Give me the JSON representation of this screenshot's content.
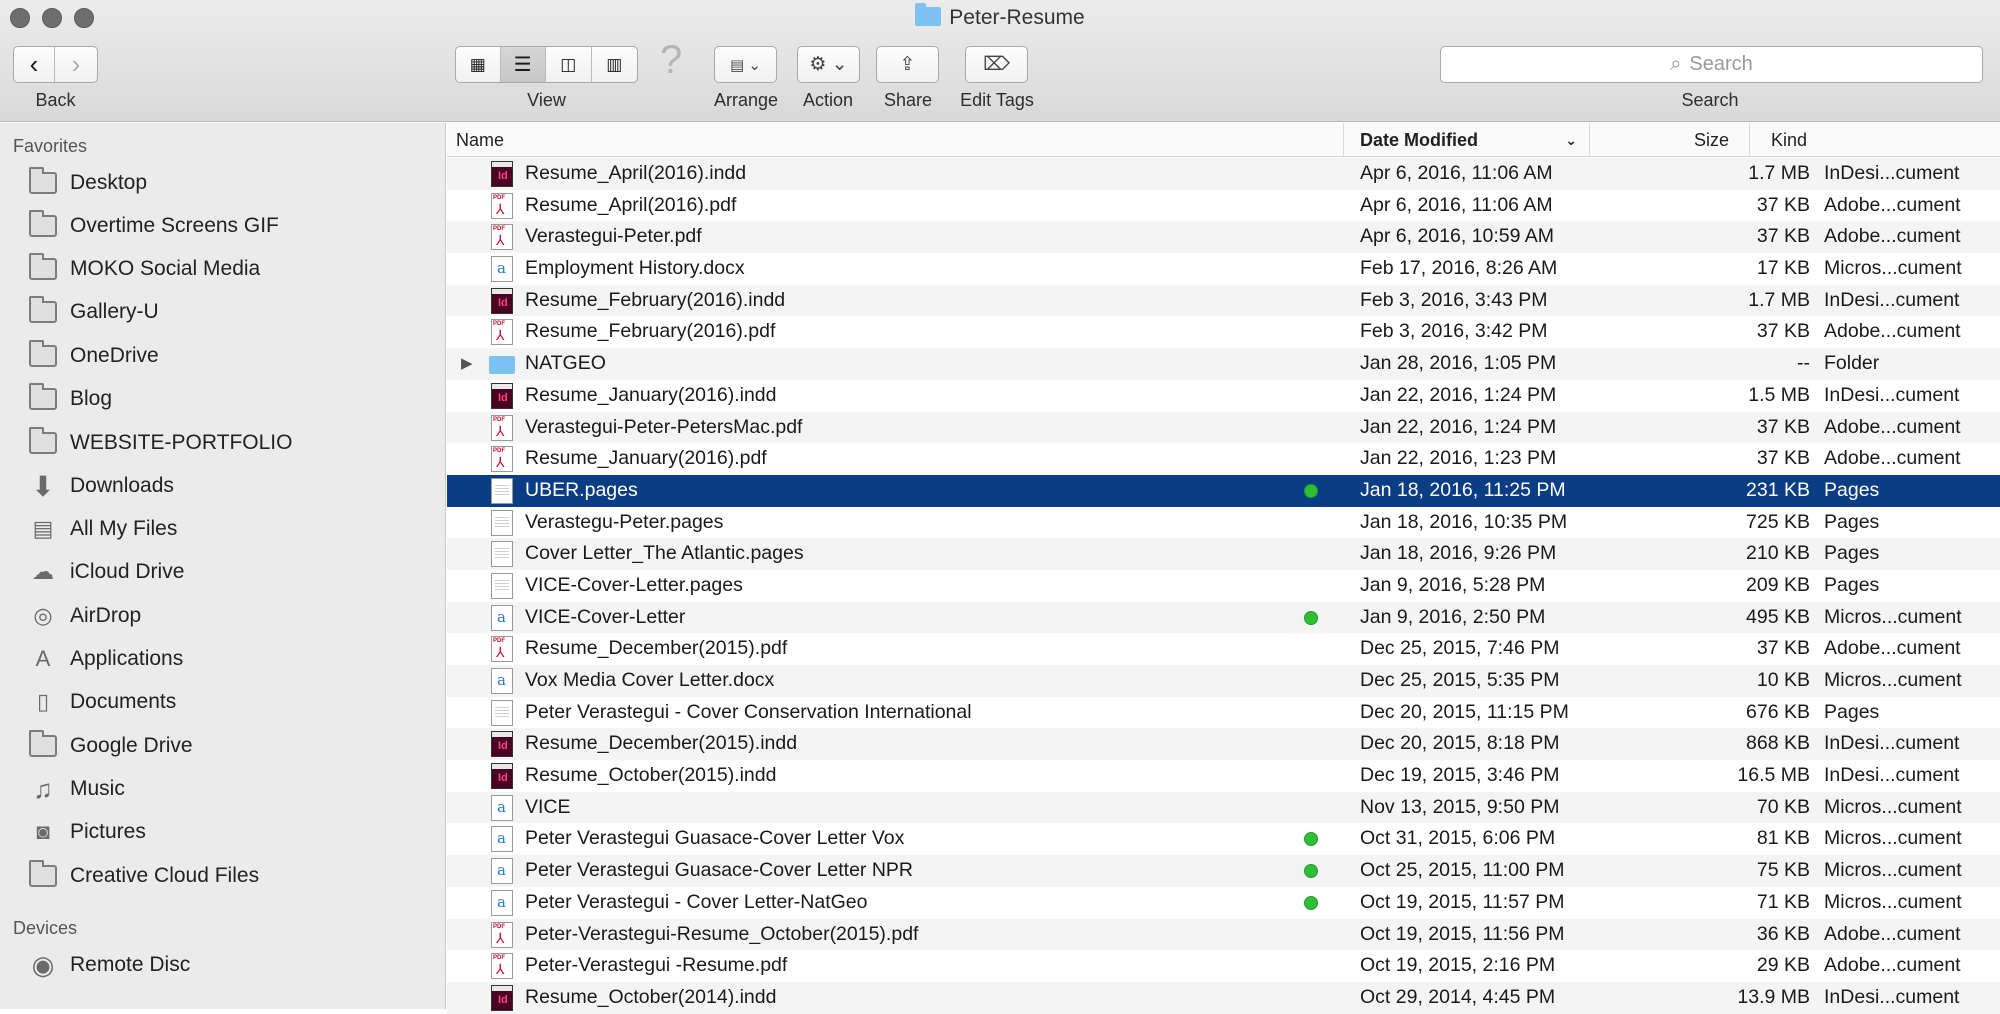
{
  "window": {
    "title": "Peter-Resume"
  },
  "toolbar": {
    "back_label": "Back",
    "view_label": "View",
    "arrange_label": "Arrange",
    "action_label": "Action",
    "share_label": "Share",
    "tags_label": "Edit Tags",
    "search_label": "Search",
    "search_placeholder": "Search"
  },
  "sidebar": {
    "favorites_header": "Favorites",
    "favorites": [
      {
        "label": "Desktop",
        "icon": "desktop-icon"
      },
      {
        "label": "Overtime Screens GIF",
        "icon": "folder-icon"
      },
      {
        "label": "MOKO Social Media",
        "icon": "folder-icon"
      },
      {
        "label": "Gallery-U",
        "icon": "folder-icon"
      },
      {
        "label": "OneDrive",
        "icon": "folder-icon"
      },
      {
        "label": "Blog",
        "icon": "folder-icon"
      },
      {
        "label": "WEBSITE-PORTFOLIO",
        "icon": "folder-icon"
      },
      {
        "label": "Downloads",
        "icon": "download-icon"
      },
      {
        "label": "All My Files",
        "icon": "all-files-icon"
      },
      {
        "label": "iCloud Drive",
        "icon": "cloud-icon"
      },
      {
        "label": "AirDrop",
        "icon": "airdrop-icon"
      },
      {
        "label": "Applications",
        "icon": "applications-icon"
      },
      {
        "label": "Documents",
        "icon": "documents-icon"
      },
      {
        "label": "Google Drive",
        "icon": "folder-icon"
      },
      {
        "label": "Music",
        "icon": "music-icon"
      },
      {
        "label": "Pictures",
        "icon": "camera-icon"
      },
      {
        "label": "Creative Cloud Files",
        "icon": "folder-icon"
      }
    ],
    "devices_header": "Devices",
    "devices": [
      {
        "label": "Remote Disc",
        "icon": "disc-icon"
      }
    ]
  },
  "columns": {
    "name": "Name",
    "date": "Date Modified",
    "size": "Size",
    "kind": "Kind"
  },
  "files": [
    {
      "name": "Resume_April(2016).indd",
      "date": "Apr 6, 2016, 11:06 AM",
      "size": "1.7 MB",
      "kind": "InDesi...cument",
      "icon": "indd"
    },
    {
      "name": "Resume_April(2016).pdf",
      "date": "Apr 6, 2016, 11:06 AM",
      "size": "37 KB",
      "kind": "Adobe...cument",
      "icon": "pdf"
    },
    {
      "name": "Verastegui-Peter.pdf",
      "date": "Apr 6, 2016, 10:59 AM",
      "size": "37 KB",
      "kind": "Adobe...cument",
      "icon": "pdf"
    },
    {
      "name": "Employment History.docx",
      "date": "Feb 17, 2016, 8:26 AM",
      "size": "17 KB",
      "kind": "Micros...cument",
      "icon": "word"
    },
    {
      "name": "Resume_February(2016).indd",
      "date": "Feb 3, 2016, 3:43 PM",
      "size": "1.7 MB",
      "kind": "InDesi...cument",
      "icon": "indd"
    },
    {
      "name": "Resume_February(2016).pdf",
      "date": "Feb 3, 2016, 3:42 PM",
      "size": "37 KB",
      "kind": "Adobe...cument",
      "icon": "pdf"
    },
    {
      "name": "NATGEO",
      "date": "Jan 28, 2016, 1:05 PM",
      "size": "--",
      "kind": "Folder",
      "icon": "folder",
      "disclosure": "▶"
    },
    {
      "name": "Resume_January(2016).indd",
      "date": "Jan 22, 2016, 1:24 PM",
      "size": "1.5 MB",
      "kind": "InDesi...cument",
      "icon": "indd"
    },
    {
      "name": "Verastegui-Peter-PetersMac.pdf",
      "date": "Jan 22, 2016, 1:24 PM",
      "size": "37 KB",
      "kind": "Adobe...cument",
      "icon": "pdf"
    },
    {
      "name": "Resume_January(2016).pdf",
      "date": "Jan 22, 2016, 1:23 PM",
      "size": "37 KB",
      "kind": "Adobe...cument",
      "icon": "pdf"
    },
    {
      "name": "UBER.pages",
      "date": "Jan 18, 2016, 11:25 PM",
      "size": "231 KB",
      "kind": "Pages",
      "icon": "pages",
      "selected": true,
      "tag": "green"
    },
    {
      "name": "Verastegu-Peter.pages",
      "date": "Jan 18, 2016, 10:35 PM",
      "size": "725 KB",
      "kind": "Pages",
      "icon": "pages"
    },
    {
      "name": "Cover Letter_The Atlantic.pages",
      "date": "Jan 18, 2016, 9:26 PM",
      "size": "210 KB",
      "kind": "Pages",
      "icon": "pages"
    },
    {
      "name": "VICE-Cover-Letter.pages",
      "date": "Jan 9, 2016, 5:28 PM",
      "size": "209 KB",
      "kind": "Pages",
      "icon": "pages"
    },
    {
      "name": "VICE-Cover-Letter",
      "date": "Jan 9, 2016, 2:50 PM",
      "size": "495 KB",
      "kind": "Micros...cument",
      "icon": "word",
      "tag": "green"
    },
    {
      "name": "Resume_December(2015).pdf",
      "date": "Dec 25, 2015, 7:46 PM",
      "size": "37 KB",
      "kind": "Adobe...cument",
      "icon": "pdf"
    },
    {
      "name": "Vox Media Cover Letter.docx",
      "date": "Dec 25, 2015, 5:35 PM",
      "size": "10 KB",
      "kind": "Micros...cument",
      "icon": "word"
    },
    {
      "name": "Peter Verastegui - Cover Conservation International",
      "date": "Dec 20, 2015, 11:15 PM",
      "size": "676 KB",
      "kind": "Pages",
      "icon": "pages"
    },
    {
      "name": "Resume_December(2015).indd",
      "date": "Dec 20, 2015, 8:18 PM",
      "size": "868 KB",
      "kind": "InDesi...cument",
      "icon": "indd"
    },
    {
      "name": "Resume_October(2015).indd",
      "date": "Dec 19, 2015, 3:46 PM",
      "size": "16.5 MB",
      "kind": "InDesi...cument",
      "icon": "indd"
    },
    {
      "name": "VICE",
      "date": "Nov 13, 2015, 9:50 PM",
      "size": "70 KB",
      "kind": "Micros...cument",
      "icon": "word"
    },
    {
      "name": "Peter Verastegui Guasace-Cover Letter Vox",
      "date": "Oct 31, 2015, 6:06 PM",
      "size": "81 KB",
      "kind": "Micros...cument",
      "icon": "word",
      "tag": "green"
    },
    {
      "name": "Peter Verastegui Guasace-Cover Letter NPR",
      "date": "Oct 25, 2015, 11:00 PM",
      "size": "75 KB",
      "kind": "Micros...cument",
      "icon": "word",
      "tag": "green"
    },
    {
      "name": "Peter Verastegui - Cover Letter-NatGeo",
      "date": "Oct 19, 2015, 11:57 PM",
      "size": "71 KB",
      "kind": "Micros...cument",
      "icon": "word",
      "tag": "green"
    },
    {
      "name": "Peter-Verastegui-Resume_October(2015).pdf",
      "date": "Oct 19, 2015, 11:56 PM",
      "size": "36 KB",
      "kind": "Adobe...cument",
      "icon": "pdf"
    },
    {
      "name": "Peter-Verastegui -Resume.pdf",
      "date": "Oct 19, 2015, 2:16 PM",
      "size": "29 KB",
      "kind": "Adobe...cument",
      "icon": "pdf"
    },
    {
      "name": "Resume_October(2014).indd",
      "date": "Oct 29, 2014, 4:45 PM",
      "size": "13.9 MB",
      "kind": "InDesi...cument",
      "icon": "indd"
    }
  ],
  "colors": {
    "selection": "#0b3d84",
    "tag_green": "#2fbf36",
    "folder_blue": "#7cc2f2"
  }
}
